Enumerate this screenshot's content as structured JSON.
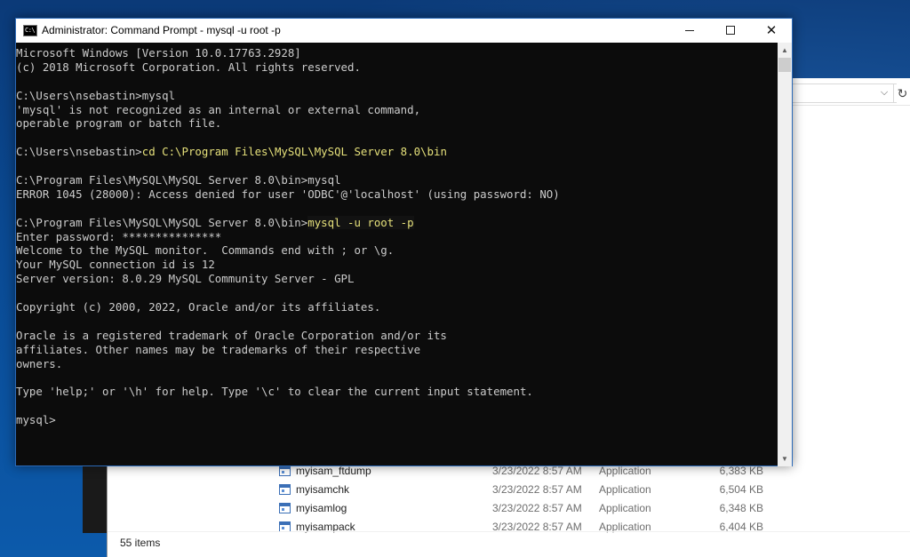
{
  "cmd_window": {
    "title": "Administrator: Command Prompt - mysql  -u root -p",
    "icon_label": "C:\\",
    "controls": {
      "minimize": "minimize",
      "maximize": "maximize",
      "close": "✕"
    },
    "lines": [
      {
        "prefix": "Microsoft Windows [Version 10.0.17763.2928]",
        "typed": ""
      },
      {
        "prefix": "(c) 2018 Microsoft Corporation. All rights reserved.",
        "typed": ""
      },
      {
        "prefix": "",
        "typed": ""
      },
      {
        "prefix": "C:\\Users\\nsebastin>mysql",
        "typed": ""
      },
      {
        "prefix": "'mysql' is not recognized as an internal or external command,",
        "typed": ""
      },
      {
        "prefix": "operable program or batch file.",
        "typed": ""
      },
      {
        "prefix": "",
        "typed": ""
      },
      {
        "prefix": "C:\\Users\\nsebastin>",
        "typed": "cd C:\\Program Files\\MySQL\\MySQL Server 8.0\\bin"
      },
      {
        "prefix": "",
        "typed": ""
      },
      {
        "prefix": "C:\\Program Files\\MySQL\\MySQL Server 8.0\\bin>mysql",
        "typed": ""
      },
      {
        "prefix": "ERROR 1045 (28000): Access denied for user 'ODBC'@'localhost' (using password: NO)",
        "typed": ""
      },
      {
        "prefix": "",
        "typed": ""
      },
      {
        "prefix": "C:\\Program Files\\MySQL\\MySQL Server 8.0\\bin>",
        "typed": "mysql -u root -p"
      },
      {
        "prefix": "Enter password: ***************",
        "typed": ""
      },
      {
        "prefix": "Welcome to the MySQL monitor.  Commands end with ; or \\g.",
        "typed": ""
      },
      {
        "prefix": "Your MySQL connection id is 12",
        "typed": ""
      },
      {
        "prefix": "Server version: 8.0.29 MySQL Community Server - GPL",
        "typed": ""
      },
      {
        "prefix": "",
        "typed": ""
      },
      {
        "prefix": "Copyright (c) 2000, 2022, Oracle and/or its affiliates.",
        "typed": ""
      },
      {
        "prefix": "",
        "typed": ""
      },
      {
        "prefix": "Oracle is a registered trademark of Oracle Corporation and/or its",
        "typed": ""
      },
      {
        "prefix": "affiliates. Other names may be trademarks of their respective",
        "typed": ""
      },
      {
        "prefix": "owners.",
        "typed": ""
      },
      {
        "prefix": "",
        "typed": ""
      },
      {
        "prefix": "Type 'help;' or '\\h' for help. Type '\\c' to clear the current input statement.",
        "typed": ""
      },
      {
        "prefix": "",
        "typed": ""
      },
      {
        "prefix": "mysql>",
        "typed": ""
      }
    ],
    "colors": {
      "background": "#0c0c0c",
      "text": "#cccccc",
      "typed": "#e5e07a"
    }
  },
  "explorer": {
    "files": [
      {
        "name": "myisam_ftdump",
        "date": "3/23/2022 8:57 AM",
        "type": "Application",
        "size": "6,383 KB"
      },
      {
        "name": "myisamchk",
        "date": "3/23/2022 8:57 AM",
        "type": "Application",
        "size": "6,504 KB"
      },
      {
        "name": "myisamlog",
        "date": "3/23/2022 8:57 AM",
        "type": "Application",
        "size": "6,348 KB"
      },
      {
        "name": "myisampack",
        "date": "3/23/2022 8:57 AM",
        "type": "Application",
        "size": "6,404 KB"
      }
    ],
    "status": "55 items",
    "icons": {
      "dropdown": "chevron-down-icon",
      "refresh": "refresh-icon",
      "file": "application-icon"
    },
    "glyphs": {
      "dropdown": "⌵",
      "refresh": "↻"
    }
  }
}
